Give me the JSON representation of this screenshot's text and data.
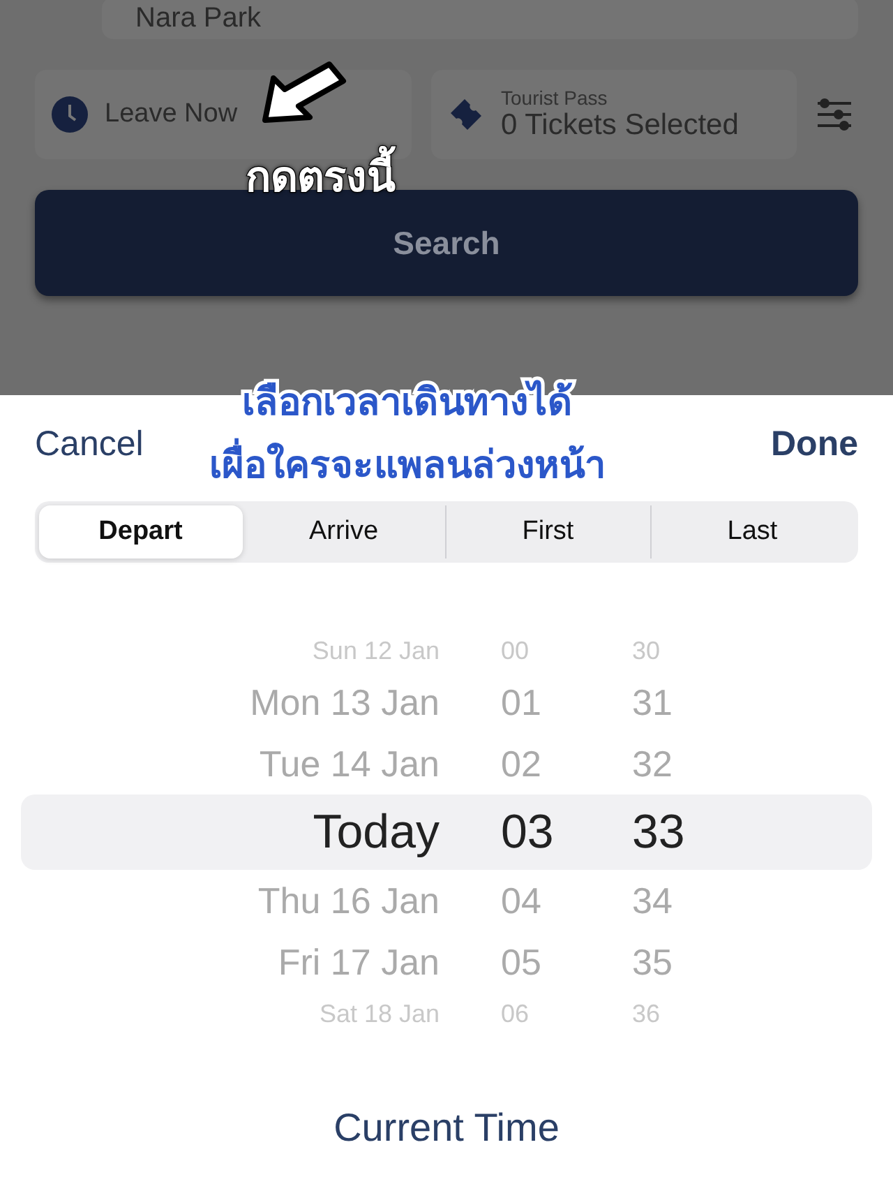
{
  "background": {
    "destination": "Nara Park",
    "time_field": {
      "label": "Leave Now"
    },
    "pass_field": {
      "caption": "Tourist Pass",
      "value": "0 Tickets Selected"
    },
    "search_button": "Search"
  },
  "sheet": {
    "cancel": "Cancel",
    "done": "Done",
    "modes": [
      {
        "label": "Depart",
        "selected": true
      },
      {
        "label": "Arrive",
        "selected": false
      },
      {
        "label": "First",
        "selected": false
      },
      {
        "label": "Last",
        "selected": false
      }
    ],
    "picker_rows": [
      {
        "day": "Sun 12 Jan",
        "hour": "00",
        "minute": "30",
        "selected": false
      },
      {
        "day": "Mon 13 Jan",
        "hour": "01",
        "minute": "31",
        "selected": false
      },
      {
        "day": "Tue 14 Jan",
        "hour": "02",
        "minute": "32",
        "selected": false
      },
      {
        "day": "Today",
        "hour": "03",
        "minute": "33",
        "selected": true
      },
      {
        "day": "Thu 16 Jan",
        "hour": "04",
        "minute": "34",
        "selected": false
      },
      {
        "day": "Fri 17 Jan",
        "hour": "05",
        "minute": "35",
        "selected": false
      },
      {
        "day": "Sat 18 Jan",
        "hour": "06",
        "minute": "36",
        "selected": false
      }
    ],
    "current_time": "Current Time"
  },
  "annotations": {
    "tap_hint": "กดตรงนี้",
    "caption_lines": [
      "เลือกเวลาเดินทางได้",
      "เผื่อใครจะแพลนล่วงหน้า"
    ]
  }
}
